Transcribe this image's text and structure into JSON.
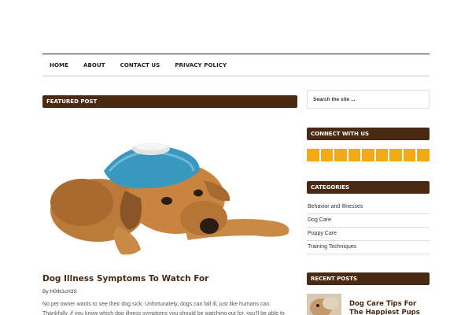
{
  "nav": {
    "items": [
      "HOME",
      "ABOUT",
      "CONTACT US",
      "PRIVACY POLICY"
    ]
  },
  "featured": {
    "heading": "FEATURED POST",
    "post_title": "Dog Illness Symptoms To Watch For",
    "byline_prefix": "By",
    "author": "H0tN1cH3S",
    "excerpt": "No pet owner wants to see their dog sick. Unfortunately, dogs can fall ill, just like humans can. Thankfully, if you know which dog illness symptoms you should be watching out for, you'll be able to make sure your"
  },
  "sidebar": {
    "search_placeholder": "Search the site ...",
    "connect_heading": "CONNECT WITH US",
    "social_count": 9,
    "social_color": "#f3aa16",
    "categories_heading": "CATEGORIES",
    "categories": [
      "Behavior and Illnesses",
      "Dog Care",
      "Puppy Care",
      "Training Techniques"
    ],
    "recent_heading": "RECENT POSTS",
    "recent_post_title": "Dog Care Tips For The Happiest Pups"
  },
  "colors": {
    "brand": "#4a2a12",
    "accent": "#f3aa16"
  }
}
